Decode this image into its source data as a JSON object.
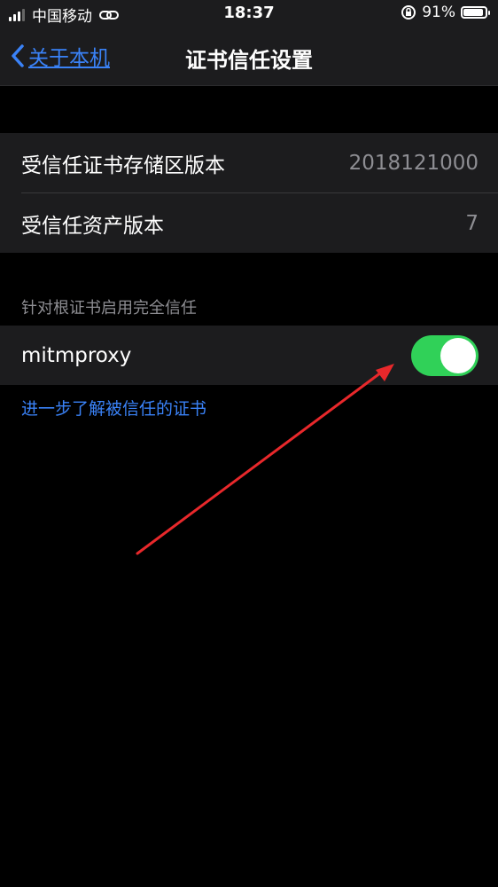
{
  "status_bar": {
    "carrier": "中国移动",
    "time": "18:37",
    "battery": "91%",
    "battery_level": 0.91
  },
  "nav": {
    "back_label": "关于本机",
    "title": "证书信任设置"
  },
  "info_rows": [
    {
      "label": "受信任证书存储区版本",
      "value": "2018121000"
    },
    {
      "label": "受信任资产版本",
      "value": "7"
    }
  ],
  "section_header": "针对根证书启用完全信任",
  "cert_row": {
    "label": "mitmproxy",
    "enabled": true
  },
  "learn_more_link": "进一步了解被信任的证书",
  "colors": {
    "accent": "#3a82f7",
    "toggle_on": "#30d158",
    "arrow": "#e8282b"
  }
}
